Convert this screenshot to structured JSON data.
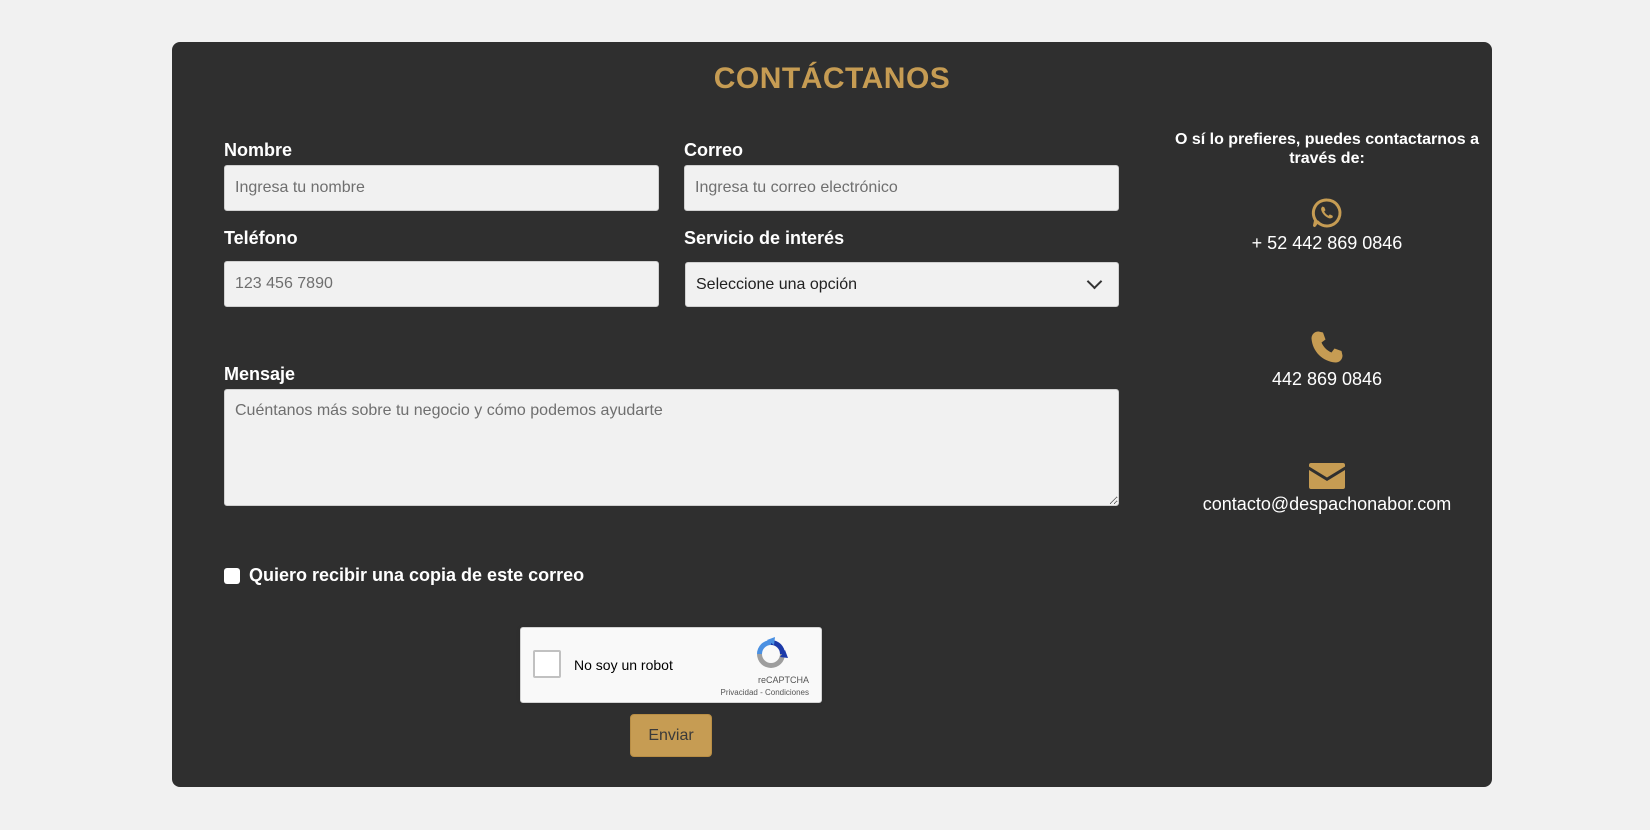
{
  "form": {
    "title": "CONTÁCTANOS",
    "name": {
      "label": "Nombre",
      "placeholder": "Ingresa tu nombre"
    },
    "email": {
      "label": "Correo",
      "placeholder": "Ingresa tu correo electrónico"
    },
    "phone": {
      "label": "Teléfono",
      "placeholder": "123 456 7890"
    },
    "service": {
      "label": "Servicio de interés",
      "selected": "Seleccione una opción"
    },
    "message": {
      "label": "Mensaje",
      "placeholder": "Cuéntanos más sobre tu negocio y cómo podemos ayudarte"
    },
    "copy_checkbox": {
      "label": "Quiero recibir una copia de este correo",
      "checked": false
    },
    "captcha": {
      "label": "No soy un robot",
      "brand": "reCAPTCHA",
      "links": "Privacidad - Condiciones"
    },
    "submit_label": "Enviar"
  },
  "sidebar": {
    "heading": "O sí lo prefieres, puedes contactarnos a través de:",
    "contacts": [
      {
        "icon": "whatsapp-icon",
        "text": "+ 52 442 869 0846"
      },
      {
        "icon": "phone-icon",
        "text": "442 869 0846"
      },
      {
        "icon": "envelope-icon",
        "text": "contacto@despachonabor.com"
      }
    ]
  },
  "colors": {
    "accent": "#c69c53",
    "card_background": "#2f2f2f",
    "page_background": "#f1f1f1"
  }
}
